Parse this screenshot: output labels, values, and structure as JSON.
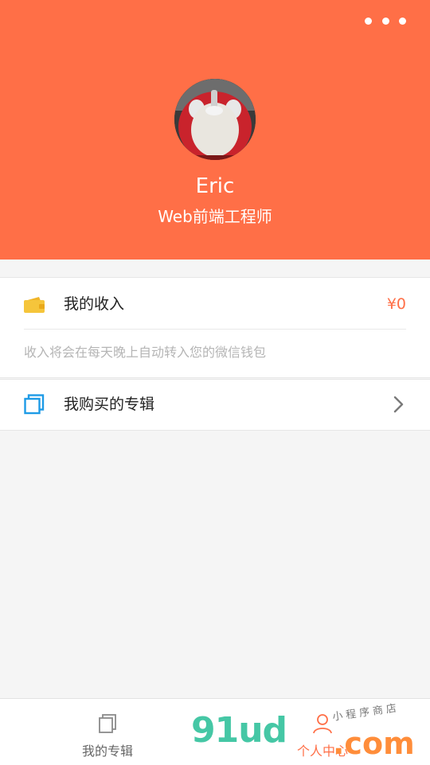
{
  "profile": {
    "name": "Eric",
    "title": "Web前端工程师"
  },
  "header": {
    "more_icon": "more-dots-icon"
  },
  "income": {
    "label": "我的收入",
    "amount": "¥0",
    "tip": "收入将会在每天晚上自动转入您的微信钱包",
    "icon": "wallet-icon"
  },
  "album": {
    "label": "我购买的专辑",
    "icon": "copy-icon"
  },
  "tabbar": {
    "tabs": [
      {
        "label": "我的专辑",
        "icon": "copy-icon"
      },
      {
        "label": "个人中心",
        "icon": "person-icon"
      }
    ]
  },
  "watermark": {
    "main": "91ud",
    "suffix": ".com",
    "sub": "小程序商店"
  },
  "colors": {
    "accent": "#ff6f47",
    "background": "#f5f5f5",
    "wallet": "#f5c53b",
    "copy_icon": "#1e9be6"
  }
}
